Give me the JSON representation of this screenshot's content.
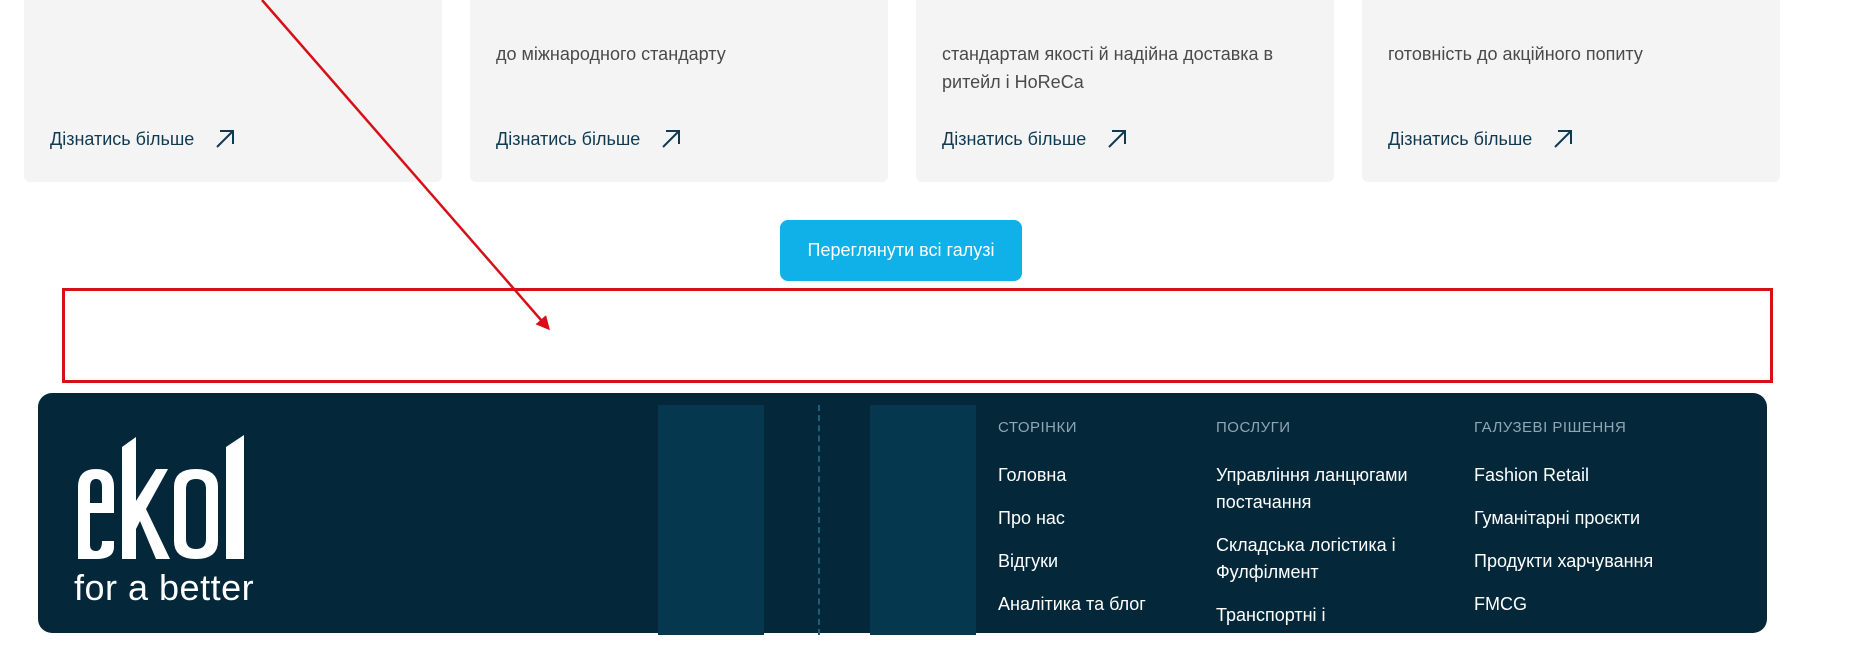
{
  "cards": [
    {
      "text_lines": [],
      "link_label": "Дізнатись більше"
    },
    {
      "text_lines": [
        "до міжнародного стандарту"
      ],
      "link_label": "Дізнатись більше"
    },
    {
      "text_lines": [
        "стандартам якості й надійна доставка в",
        "ритейл і HoReCa"
      ],
      "link_label": "Дізнатись більше"
    },
    {
      "text_lines": [
        "готовність до акційного попиту"
      ],
      "link_label": "Дізнатись більше"
    }
  ],
  "view_all_button": "Переглянути всі галузі",
  "footer": {
    "logo_text": "ekol",
    "tagline": "for a better",
    "columns": [
      {
        "heading": "СТОРІНКИ",
        "items": [
          "Головна",
          "Про нас",
          "Відгуки",
          "Аналітика та блог"
        ]
      },
      {
        "heading": "ПОСЛУГИ",
        "items": [
          "Управління ланцюгами постачання",
          "Складська логістика і Фулфілмент",
          "Транспортні і"
        ]
      },
      {
        "heading": "ГАЛУЗЕВІ РІШЕННЯ",
        "items": [
          "Fashion Retail",
          "Гуманітарні проєкти",
          "Продукти харчування",
          "FMCG"
        ]
      }
    ]
  },
  "colors": {
    "primary_button": "#0fb1e8",
    "footer_bg": "#04283a",
    "annotation_red": "#d70f17",
    "card_bg": "#f4f4f4"
  },
  "icons": {
    "card_link": "arrow-up-right-icon"
  }
}
